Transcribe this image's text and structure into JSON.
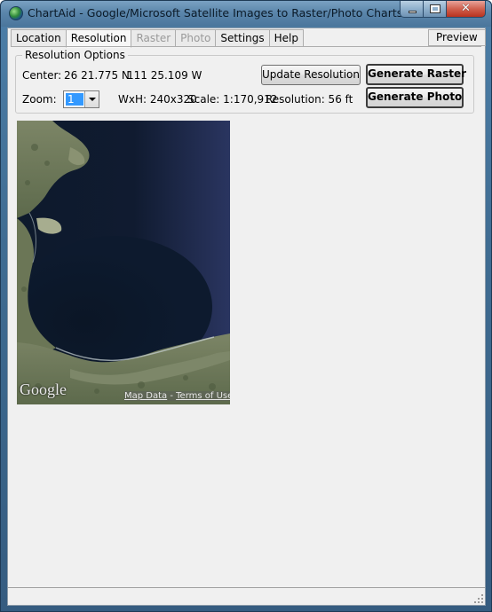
{
  "window": {
    "title": "ChartAid - Google/Microsoft Satellite Images to Raster/Photo Charts",
    "icon": "globe-icon"
  },
  "tabs": [
    {
      "label": "Location",
      "state": "normal"
    },
    {
      "label": "Resolution",
      "state": "active"
    },
    {
      "label": "Raster",
      "state": "disabled"
    },
    {
      "label": "Photo",
      "state": "disabled"
    },
    {
      "label": "Settings",
      "state": "normal"
    },
    {
      "label": "Help",
      "state": "normal"
    }
  ],
  "preview_tab": "Preview",
  "resolution_options": {
    "legend": "Resolution Options",
    "center_label": "Center:",
    "center_lat": "26 21.775 N",
    "center_lon": "111 25.109 W",
    "zoom_label": "Zoom:",
    "zoom_value": "1",
    "size_text": "WxH: 240x320",
    "scale_text": "Scale: 1:170,912",
    "resolution_text": "Resolution: 56 ft",
    "update_button": "Update Resolution",
    "generate_raster_button": "Generate Raster",
    "generate_photo_button": "Generate Photo"
  },
  "map": {
    "logo": "Google",
    "map_data_link": "Map Data",
    "separator": " - ",
    "terms_link": "Terms of Use"
  },
  "colors": {
    "water": "#0e1a2e",
    "land": "#6f7a5e",
    "active_selection": "#3399ff"
  }
}
